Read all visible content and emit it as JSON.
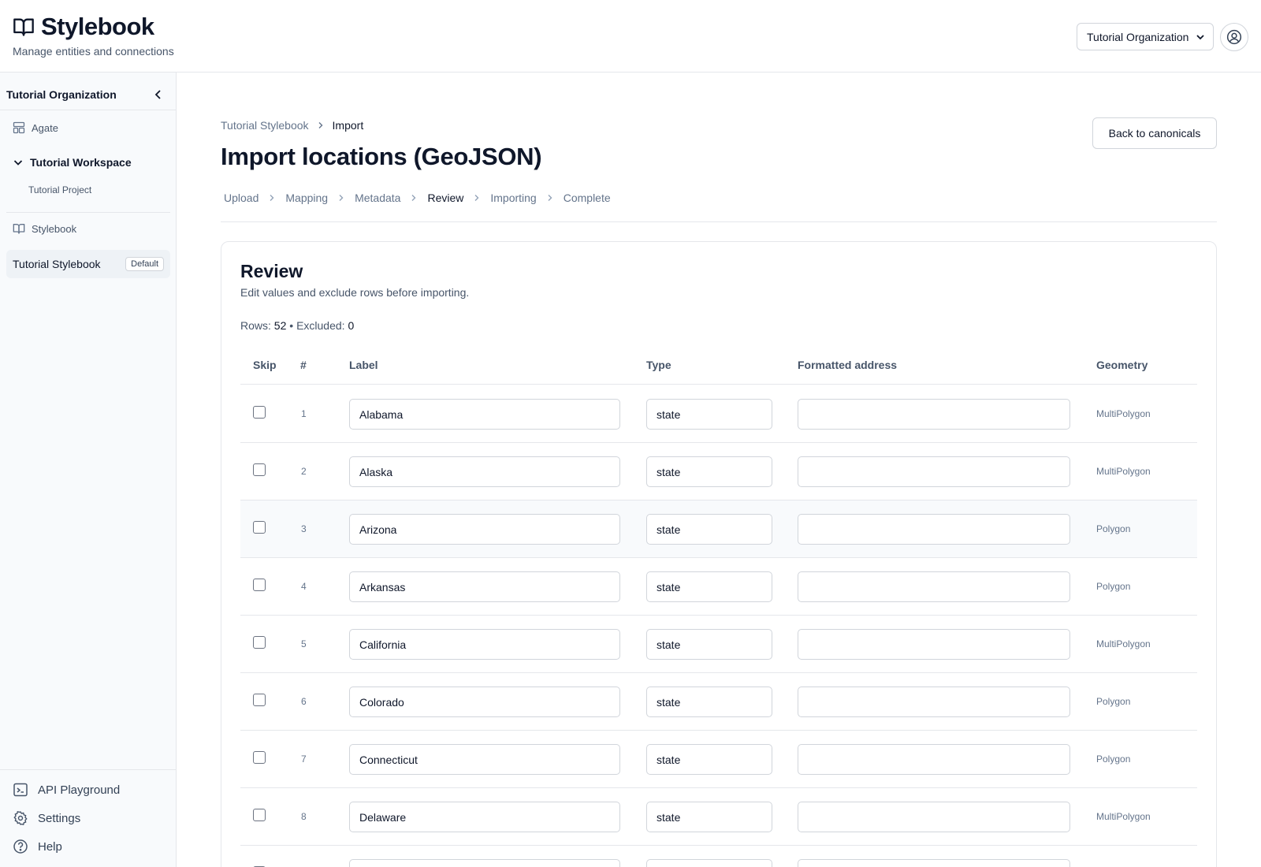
{
  "app": {
    "name": "Stylebook",
    "tagline": "Manage entities and connections",
    "org_select_value": "Tutorial Organization"
  },
  "sidebar": {
    "org_name": "Tutorial Organization",
    "agate_label": "Agate",
    "workspace_label": "Tutorial Workspace",
    "project_label": "Tutorial Project",
    "stylebook_section_label": "Stylebook",
    "active_stylebook": "Tutorial Stylebook",
    "active_stylebook_badge": "Default",
    "bottom_links": [
      {
        "label": "API Playground"
      },
      {
        "label": "Settings"
      },
      {
        "label": "Help"
      }
    ]
  },
  "page": {
    "breadcrumb": [
      "Tutorial Stylebook",
      "Import"
    ],
    "title": "Import locations (GeoJSON)",
    "back_button": "Back to canonicals",
    "steps": [
      "Upload",
      "Mapping",
      "Metadata",
      "Review",
      "Importing",
      "Complete"
    ],
    "active_step": "Review"
  },
  "review": {
    "title": "Review",
    "subtitle": "Edit values and exclude rows before importing.",
    "rows_label": "Rows:",
    "rows_count": "52",
    "separator": "•",
    "excluded_label": "Excluded:",
    "excluded_count": "0",
    "columns": [
      "Skip",
      "#",
      "Label",
      "Type",
      "Formatted address",
      "Geometry"
    ],
    "rows": [
      {
        "num": "1",
        "label": "Alabama",
        "type": "state",
        "address": "",
        "geometry": "MultiPolygon",
        "skip": false
      },
      {
        "num": "2",
        "label": "Alaska",
        "type": "state",
        "address": "",
        "geometry": "MultiPolygon",
        "skip": false
      },
      {
        "num": "3",
        "label": "Arizona",
        "type": "state",
        "address": "",
        "geometry": "Polygon",
        "skip": false
      },
      {
        "num": "4",
        "label": "Arkansas",
        "type": "state",
        "address": "",
        "geometry": "Polygon",
        "skip": false
      },
      {
        "num": "5",
        "label": "California",
        "type": "state",
        "address": "",
        "geometry": "MultiPolygon",
        "skip": false
      },
      {
        "num": "6",
        "label": "Colorado",
        "type": "state",
        "address": "",
        "geometry": "Polygon",
        "skip": false
      },
      {
        "num": "7",
        "label": "Connecticut",
        "type": "state",
        "address": "",
        "geometry": "Polygon",
        "skip": false
      },
      {
        "num": "8",
        "label": "Delaware",
        "type": "state",
        "address": "",
        "geometry": "MultiPolygon",
        "skip": false
      },
      {
        "num": "",
        "label": "",
        "type": "",
        "address": "",
        "geometry": "",
        "skip": false
      }
    ]
  }
}
